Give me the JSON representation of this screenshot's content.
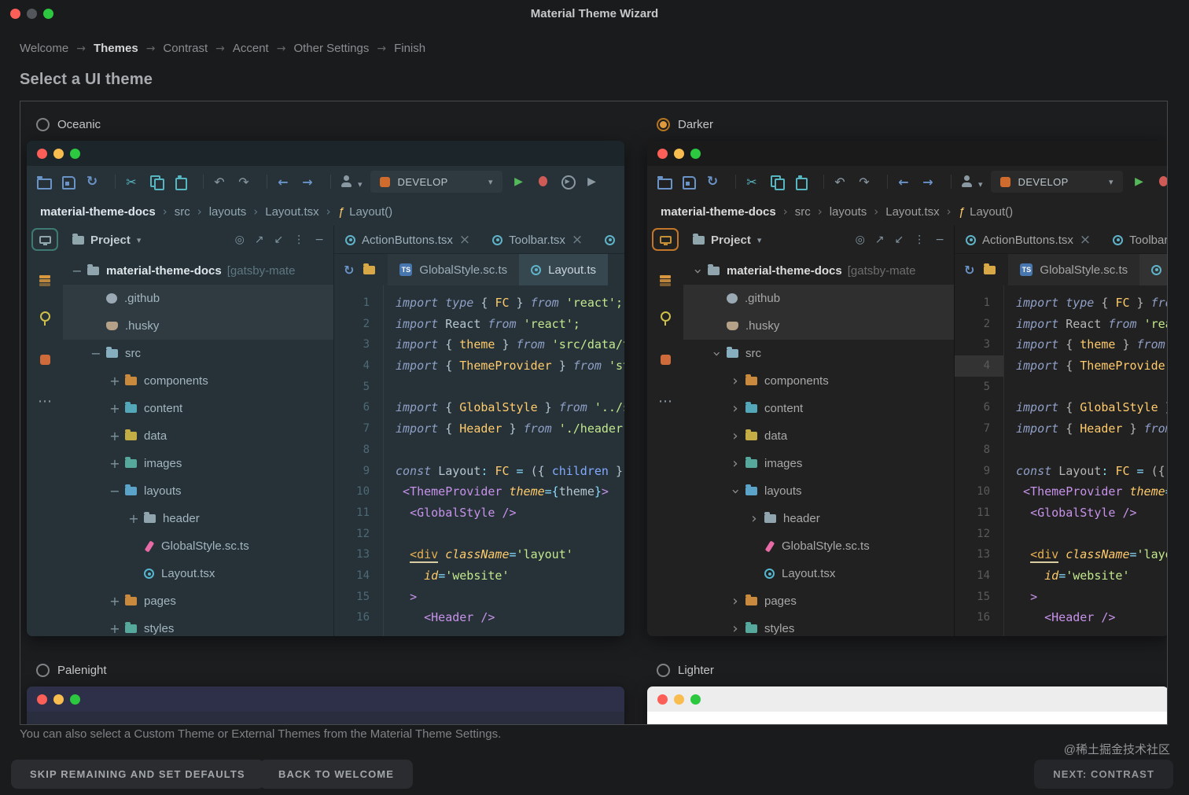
{
  "window": {
    "title": "Material Theme Wizard"
  },
  "wizard_steps": {
    "items": [
      "Welcome",
      "Themes",
      "Contrast",
      "Accent",
      "Other Settings",
      "Finish"
    ],
    "active": "Themes",
    "separator": "→"
  },
  "page_title": "Select a UI theme",
  "hint": "You can also select a Custom Theme or External Themes from the Material Theme Settings.",
  "watermark": "@稀土掘金技术社区",
  "accent_color": "#E09A3E",
  "buttons": {
    "skip": "SKIP REMAINING AND SET DEFAULTS",
    "back": "BACK TO WELCOME",
    "next": "NEXT: CONTRAST"
  },
  "themes": [
    {
      "name": "Oceanic",
      "selected": false,
      "variant": "oceanic",
      "preview": "full",
      "bg": "#263238"
    },
    {
      "name": "Darker",
      "selected": true,
      "variant": "darker",
      "preview": "full",
      "bg": "#212121"
    },
    {
      "name": "Palenight",
      "selected": false,
      "variant": "palenight",
      "preview": "sliver",
      "titlebar_color": "#2D3048",
      "body_color": "#292D3E"
    },
    {
      "name": "Lighter",
      "selected": false,
      "variant": "lighter",
      "preview": "sliver",
      "titlebar_color": "#EDEDED",
      "body_color": "#FFFFFF"
    }
  ],
  "ide": {
    "toolbar": {
      "left_icons": [
        "open-folder",
        "save",
        "sync",
        "|",
        "cut",
        "copy",
        "paste",
        "|",
        "undo",
        "redo",
        "|",
        "back",
        "forward",
        "|",
        "user"
      ],
      "run_config": "DEVELOP",
      "run_icons": [
        "run",
        "debug",
        "coverage",
        "play"
      ]
    },
    "strip_icons": [
      "monitor",
      "layers",
      "pin",
      "square",
      "more"
    ],
    "path": [
      {
        "t": "material-theme-docs",
        "bold": true
      },
      {
        "t": "src"
      },
      {
        "t": "layouts"
      },
      {
        "t": "Layout.tsx"
      },
      {
        "t": "Layout()",
        "fn": true
      }
    ],
    "project": {
      "title": "Project",
      "tools": [
        "target",
        "expand",
        "collapse",
        "kebab",
        "hide"
      ],
      "tree": [
        {
          "d": 0,
          "x": "open",
          "icon": "dir",
          "color": "#90A4AE",
          "label": "material-theme-docs",
          "suffix": " [gatsby-mate",
          "bold": true
        },
        {
          "d": 1,
          "x": "",
          "icon": "github",
          "color": "#9AA9B3",
          "label": ".github",
          "hl": true
        },
        {
          "d": 1,
          "x": "",
          "icon": "husky",
          "color": "#B5A188",
          "label": ".husky",
          "hl": true
        },
        {
          "d": 1,
          "x": "open",
          "icon": "folder",
          "color": "#86AEBF",
          "label": "src"
        },
        {
          "d": 2,
          "x": "closed",
          "icon": "folder",
          "color": "#C98A3D",
          "label": "components"
        },
        {
          "d": 2,
          "x": "closed",
          "icon": "folder",
          "color": "#53A7B8",
          "label": "content"
        },
        {
          "d": 2,
          "x": "closed",
          "icon": "folder",
          "color": "#C4AD44",
          "label": "data"
        },
        {
          "d": 2,
          "x": "closed",
          "icon": "folder",
          "color": "#56A89C",
          "label": "images"
        },
        {
          "d": 2,
          "x": "open",
          "icon": "folder",
          "color": "#5BA3C9",
          "label": "layouts"
        },
        {
          "d": 3,
          "x": "closed",
          "icon": "folder",
          "color": "#90A4AE",
          "label": "header"
        },
        {
          "d": 3,
          "x": "",
          "icon": "styled",
          "color": "#E86BA8",
          "label": "GlobalStyle.sc.ts"
        },
        {
          "d": 3,
          "x": "",
          "icon": "react",
          "color": "#55B6D0",
          "label": "Layout.tsx"
        },
        {
          "d": 2,
          "x": "closed",
          "icon": "folder",
          "color": "#C98A3D",
          "label": "pages"
        },
        {
          "d": 2,
          "x": "closed",
          "icon": "folder",
          "color": "#56A89C",
          "label": "styles"
        }
      ]
    },
    "editor": {
      "tabs": [
        {
          "icon": "react",
          "label": "ActionButtons.tsx",
          "close": "×"
        },
        {
          "icon": "react",
          "label": "Toolbar.tsx",
          "close": "×"
        },
        {
          "icon": "react",
          "label": "",
          "close": ""
        }
      ],
      "subtab_bar_icons": [
        "sync",
        "folder"
      ],
      "subtabs": [
        {
          "icon": "ts",
          "label": "GlobalStyle.sc.ts",
          "active": false
        },
        {
          "icon": "react",
          "label": "Layout.ts",
          "active": true
        }
      ],
      "active_line": 4,
      "code_lines": [
        [
          [
            "k",
            "import type "
          ],
          [
            "p",
            "{ "
          ],
          [
            "id",
            "FC"
          ],
          [
            "p",
            " } "
          ],
          [
            "k",
            "from "
          ],
          [
            "s",
            "'react';"
          ]
        ],
        [
          [
            "k",
            "import "
          ],
          [
            "p",
            "React "
          ],
          [
            "k",
            "from "
          ],
          [
            "s",
            "'react';"
          ]
        ],
        [
          [
            "k",
            "import "
          ],
          [
            "p",
            "{ "
          ],
          [
            "id",
            "theme"
          ],
          [
            "p",
            " } "
          ],
          [
            "k",
            "from "
          ],
          [
            "s",
            "'src/data/theme';"
          ]
        ],
        [
          [
            "k",
            "import "
          ],
          [
            "p",
            "{ "
          ],
          [
            "id",
            "ThemeProvider"
          ],
          [
            "p",
            " } "
          ],
          [
            "k",
            "from "
          ],
          [
            "s",
            "'styled-components';"
          ]
        ],
        [],
        [
          [
            "k",
            "import "
          ],
          [
            "p",
            "{ "
          ],
          [
            "id",
            "GlobalStyle"
          ],
          [
            "p",
            " } "
          ],
          [
            "k",
            "from "
          ],
          [
            "s",
            "'../styles';"
          ]
        ],
        [
          [
            "k",
            "import "
          ],
          [
            "p",
            "{ "
          ],
          [
            "id",
            "Header"
          ],
          [
            "p",
            " } "
          ],
          [
            "k",
            "from "
          ],
          [
            "s",
            "'./header';"
          ]
        ],
        [],
        [
          [
            "k",
            "const "
          ],
          [
            "p",
            "Layout"
          ],
          [
            "o",
            ": "
          ],
          [
            "id",
            "FC"
          ],
          [
            "o",
            " = "
          ],
          [
            "p",
            "({ "
          ],
          [
            "v",
            "children"
          ],
          [
            "p",
            " })"
          ],
          [
            "o",
            " => ("
          ]
        ],
        [
          [
            "p",
            " "
          ],
          [
            "t",
            "<ThemeProvider"
          ],
          [
            "p",
            " "
          ],
          [
            "a",
            "theme"
          ],
          [
            "o",
            "={"
          ],
          [
            "p",
            "theme"
          ],
          [
            "o",
            "}"
          ],
          [
            "t",
            ">"
          ]
        ],
        [
          [
            "p",
            "  "
          ],
          [
            "t",
            "<GlobalStyle"
          ],
          [
            "p",
            " "
          ],
          [
            "t",
            "/>"
          ]
        ],
        [],
        [
          [
            "p",
            "  "
          ],
          [
            "h",
            "<div"
          ],
          [
            "p",
            " "
          ],
          [
            "a",
            "className"
          ],
          [
            "o",
            "="
          ],
          [
            "s",
            "'layout'"
          ]
        ],
        [
          [
            "p",
            "    "
          ],
          [
            "a",
            "id"
          ],
          [
            "o",
            "="
          ],
          [
            "s",
            "'website'"
          ]
        ],
        [
          [
            "p",
            "  "
          ],
          [
            "t",
            ">"
          ]
        ],
        [
          [
            "p",
            "    "
          ],
          [
            "t",
            "<Header"
          ],
          [
            "p",
            " "
          ],
          [
            "t",
            "/>"
          ]
        ]
      ]
    }
  }
}
